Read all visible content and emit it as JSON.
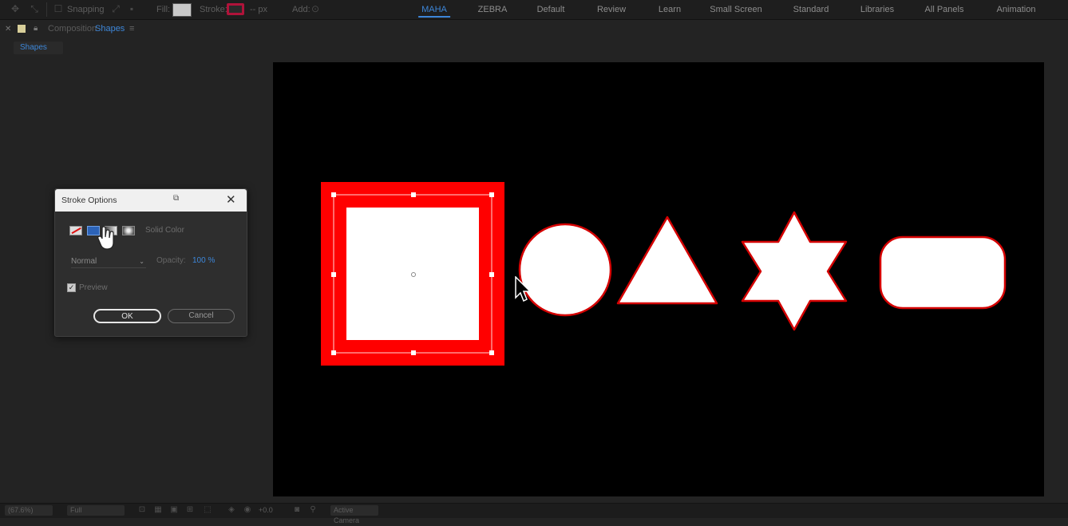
{
  "toolbar": {
    "snapping_label": "Snapping",
    "fill_label": "Fill:",
    "stroke_label": "Stroke:",
    "stroke_width": "-- px",
    "add_label": "Add:",
    "workspaces": [
      {
        "label": "MAHA",
        "active": true
      },
      {
        "label": "ZEBRA",
        "active": false
      },
      {
        "label": "Default",
        "active": false
      },
      {
        "label": "Review",
        "active": false
      },
      {
        "label": "Learn",
        "active": false
      },
      {
        "label": "Small Screen",
        "active": false
      },
      {
        "label": "Standard",
        "active": false
      },
      {
        "label": "Libraries",
        "active": false
      },
      {
        "label": "All Panels",
        "active": false
      },
      {
        "label": "Animation",
        "active": false
      }
    ]
  },
  "composition": {
    "header_prefix": "Composition",
    "name": "Shapes",
    "menu_icon": "hamburger-icon",
    "tab_label": "Shapes"
  },
  "colors": {
    "accent": "#3d86d8",
    "stroke_red": "#ff0000",
    "shape_fill": "#ffffff",
    "canvas": "#000000"
  },
  "stroke_dialog": {
    "title": "Stroke Options",
    "fill_types": [
      "none-icon",
      "solid-color-icon",
      "linear-gradient-icon",
      "radial-gradient-icon"
    ],
    "selected_fill_type": "Solid Color",
    "blend_mode": "Normal",
    "opacity_label": "Opacity:",
    "opacity_value": "100 %",
    "preview_label": "Preview",
    "preview_checked": true,
    "ok_label": "OK",
    "cancel_label": "Cancel"
  },
  "status_bar": {
    "magnification": "(67.6%)",
    "resolution": "Full",
    "exposure": "+0.0",
    "camera": "Active Camera"
  }
}
